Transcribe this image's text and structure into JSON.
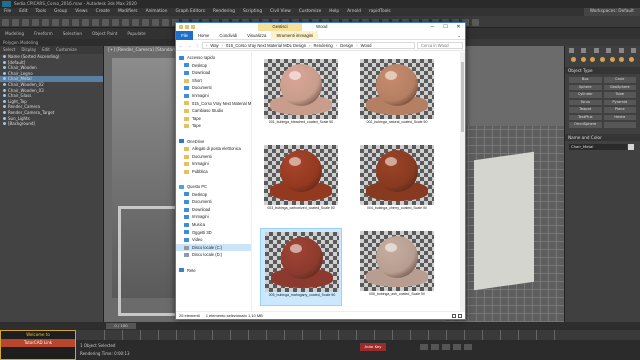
{
  "max": {
    "title": "Sedia CPICARS_Corso_2016.max - Autodesk 3ds Max 2020",
    "menu": [
      "File",
      "Edit",
      "Tools",
      "Group",
      "Views",
      "Create",
      "Modifiers",
      "Animation",
      "Graph Editors",
      "Rendering",
      "Scripting",
      "Civil View",
      "Customize",
      "Help",
      "Arnold",
      "rapidTools"
    ],
    "workspace": "Workspaces: Default",
    "ribbon": [
      "Modeling",
      "Freeform",
      "Selection",
      "Object Paint",
      "Populate"
    ],
    "subribbon": "Polygon Modeling",
    "explorer_tabs": [
      "Select",
      "Display",
      "Edit",
      "Customize"
    ],
    "scene_items": [
      {
        "label": "Name (Sorted Ascending)",
        "sel": false
      },
      {
        "label": "[default]",
        "sel": false
      },
      {
        "label": "Chair_Wooden",
        "sel": false
      },
      {
        "label": "Chair_Legno",
        "sel": false
      },
      {
        "label": "Chair_Metal",
        "sel": true
      },
      {
        "label": "Chair_Wooden_02",
        "sel": false
      },
      {
        "label": "Chair_Wooden_03",
        "sel": false
      },
      {
        "label": "Chair_Glass",
        "sel": false
      },
      {
        "label": "Light_Top",
        "sel": false
      },
      {
        "label": "Render_Camera",
        "sel": false
      },
      {
        "label": "Render_Camera_Target",
        "sel": false
      },
      {
        "label": "Sun_Lights",
        "sel": false
      },
      {
        "label": "[Background]",
        "sel": false
      }
    ],
    "viewport_label": "[+] [Render_Camera] [Standard] [Default Shading]",
    "command_panel": {
      "rollout_object_type": "Object Type",
      "autogrid": "AutoGrid",
      "buttons": [
        "Box",
        "Cone",
        "Sphere",
        "GeoSphere",
        "Cylinder",
        "Tube",
        "Torus",
        "Pyramid",
        "Teapot",
        "Plane",
        "TextPlus",
        "Hedra",
        "OmniSphere",
        ""
      ],
      "rollout_name_color": "Name and Color",
      "object_name": "Chair_Metal",
      "swatch_color": "#d6d6d6"
    },
    "timeline": "0 / 100",
    "status_selected": "1 Object Selected",
    "status_time": "Rendering Time: 0:00:13",
    "autokey": "Auto Key",
    "set_key": "Set Key",
    "welcome": {
      "line1": "Welcome to",
      "tag": "TutorCAD Link"
    }
  },
  "explorer": {
    "title": "Wood",
    "context_tab": "Gestisci",
    "ribbon_tabs": [
      "File",
      "Home",
      "Condividi",
      "Visualizza",
      "Strumenti immagini"
    ],
    "window_buttons": {
      "minimize": "─",
      "maximize": "☐",
      "close": "✕"
    },
    "path": [
      "Way",
      "015_Corso Vray Next Material MDL Design",
      "Rendering",
      "Design",
      "Wood"
    ],
    "search_placeholder": "Cerca in Wood",
    "nav": [
      {
        "label": "Accesso rapido",
        "icon": "star"
      },
      {
        "label": "Desktop",
        "icon": "blue"
      },
      {
        "label": "Download",
        "icon": "blue"
      },
      {
        "label": "Short",
        "icon": "folder"
      },
      {
        "label": "Documenti",
        "icon": "blue"
      },
      {
        "label": "Immagini",
        "icon": "blue"
      },
      {
        "label": "015_Corso Vray Next Material M",
        "icon": "folder"
      },
      {
        "label": "Cambiaso Studio",
        "icon": "folder"
      },
      {
        "label": "Tape",
        "icon": "folder"
      },
      {
        "label": "Tape",
        "icon": "folder"
      },
      {
        "label": "",
        "icon": ""
      },
      {
        "label": "OneDrive",
        "icon": "cloud"
      },
      {
        "label": "Allegati di posta elettronica",
        "icon": "folder"
      },
      {
        "label": "Documenti",
        "icon": "folder"
      },
      {
        "label": "Immagini",
        "icon": "folder"
      },
      {
        "label": "Pubblica",
        "icon": "folder"
      },
      {
        "label": "",
        "icon": ""
      },
      {
        "label": "Questo PC",
        "icon": "pc"
      },
      {
        "label": "Desktop",
        "icon": "blue"
      },
      {
        "label": "Documenti",
        "icon": "blue"
      },
      {
        "label": "Download",
        "icon": "blue"
      },
      {
        "label": "Immagini",
        "icon": "blue"
      },
      {
        "label": "Musica",
        "icon": "blue"
      },
      {
        "label": "Oggetti 3D",
        "icon": "blue"
      },
      {
        "label": "Video",
        "icon": "blue"
      },
      {
        "label": "Disco locale (C:)",
        "icon": "drive",
        "sel": true
      },
      {
        "label": "Disco locale (D:)",
        "icon": "drive"
      },
      {
        "label": "",
        "icon": ""
      },
      {
        "label": "Rete",
        "icon": "net"
      }
    ],
    "files": [
      {
        "name": "001_bubinga_bleached_coated_Scale 50",
        "ball": "#d9a596",
        "base": "#c89d8c",
        "sel": false
      },
      {
        "name": "002_bubinga_natural_coated_Scale 50",
        "ball": "#c68b6e",
        "base": "#b57f63",
        "sel": false
      },
      {
        "name": "003_bubinga_carbonized_coated_Scale 50",
        "ball": "#a8452c",
        "base": "#93391f",
        "sel": false
      },
      {
        "name": "004_bubinga_cherry_coated_Scale 50",
        "ball": "#9b4428",
        "base": "#873a20",
        "sel": false
      },
      {
        "name": "005_bubinga_mahogany_coated_Scale 50",
        "ball": "#a04435",
        "base": "#8c3a2d",
        "sel": true
      },
      {
        "name": "006_bubinga_ash_coated_Scale 50",
        "ball": "#c7ad9f",
        "base": "#b89e90",
        "sel": false
      }
    ],
    "status_count": "25 elementi",
    "status_selected": "1 elemento selezionato  1,10 MB"
  }
}
